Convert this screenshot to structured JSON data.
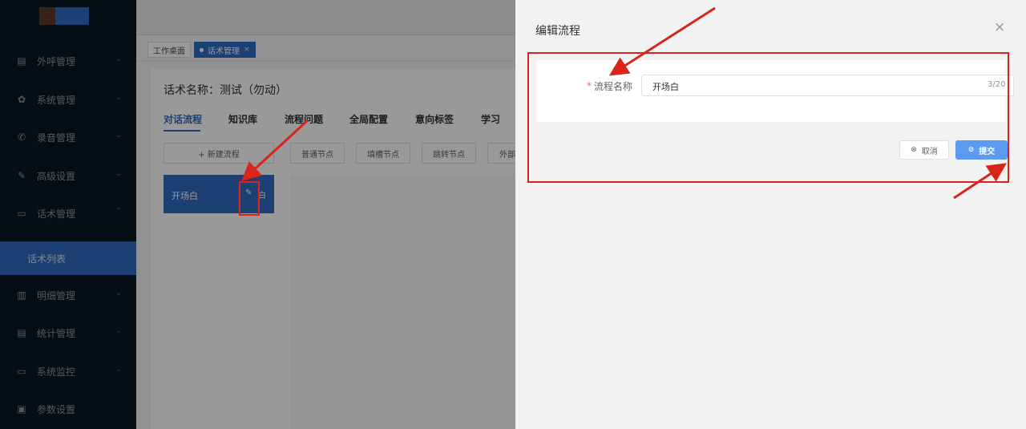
{
  "sidebar": {
    "items": [
      {
        "label": "外呼管理",
        "icon": "document-icon",
        "glyph": "▤",
        "chevron": "⌄"
      },
      {
        "label": "系统管理",
        "icon": "gear-icon",
        "glyph": "✿",
        "chevron": "⌄"
      },
      {
        "label": "录音管理",
        "icon": "phone-icon",
        "glyph": "✆",
        "chevron": "⌄"
      },
      {
        "label": "高级设置",
        "icon": "pen-icon",
        "glyph": "✎",
        "chevron": "⌄"
      },
      {
        "label": "话术管理",
        "icon": "chat-icon",
        "glyph": "▭",
        "chevron": "⌃"
      },
      {
        "label": "话术列表",
        "active": true
      },
      {
        "label": "明细管理",
        "icon": "book-icon",
        "glyph": "▥",
        "chevron": "⌄"
      },
      {
        "label": "统计管理",
        "icon": "list-icon",
        "glyph": "▤",
        "chevron": "⌄"
      },
      {
        "label": "系统监控",
        "icon": "camera-icon",
        "glyph": "▭",
        "chevron": "⌄"
      },
      {
        "label": "参数设置",
        "icon": "settings-panel-icon",
        "glyph": "▣"
      }
    ]
  },
  "page_tabs": {
    "home": "工作桌面",
    "current": "话术管理",
    "close": "×"
  },
  "content": {
    "script_name": "话术名称：测试（勿动）",
    "tabs": [
      "对话流程",
      "知识库",
      "流程问题",
      "全局配置",
      "意向标签",
      "学习"
    ],
    "toolbar": {
      "new_flow": "+ 新建流程",
      "node_normal": "普通节点",
      "node_fill": "填槽节点",
      "node_jump": "跳转节点",
      "node_external": "外部"
    },
    "flow_card": {
      "name": "开场白",
      "edit_glyph": "✎",
      "trailing": "白"
    }
  },
  "drawer": {
    "title": "编辑流程",
    "close": "×",
    "required_mark": "*",
    "field_label": "流程名称",
    "field_value": "开场白",
    "counter": "3/20",
    "cancel": "取消",
    "cancel_icon": "⊗",
    "submit": "提交",
    "submit_icon": "⊘"
  },
  "colors": {
    "sidebar_bg": "#0d1623",
    "accent": "#2f6bc0",
    "submit": "#5b9bef",
    "annotation": "#d8241a",
    "required": "#f56c6c"
  }
}
